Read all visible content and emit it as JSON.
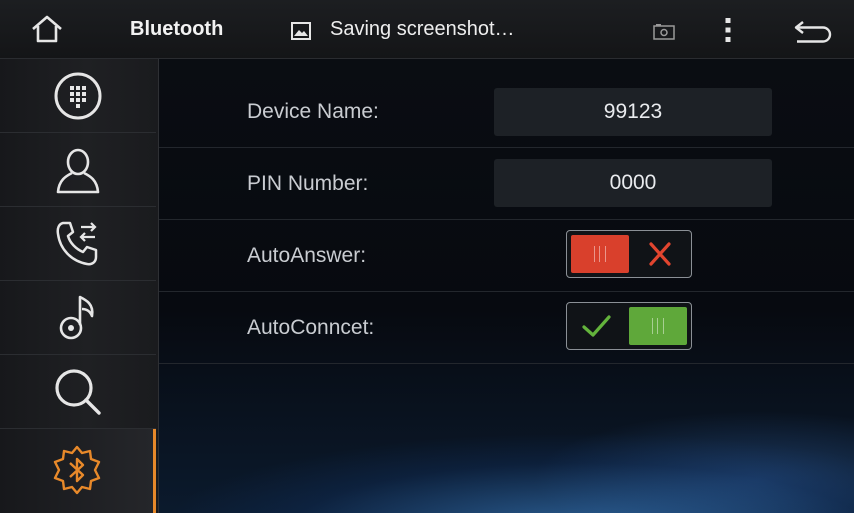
{
  "topbar": {
    "title": "Bluetooth",
    "notification": "Saving screenshot…",
    "icons": [
      "home-icon",
      "image-icon",
      "screenshot-icon",
      "overflow-menu-icon",
      "back-icon"
    ]
  },
  "sidebar": {
    "items": [
      {
        "name": "dialpad",
        "icon": "dialpad-icon"
      },
      {
        "name": "contacts",
        "icon": "person-icon"
      },
      {
        "name": "call-log",
        "icon": "phone-transfer-icon"
      },
      {
        "name": "music",
        "icon": "music-note-icon"
      },
      {
        "name": "search",
        "icon": "search-icon"
      },
      {
        "name": "bluetooth-settings",
        "icon": "bluetooth-gear-icon",
        "active": true
      }
    ],
    "active_color": "#e8892a"
  },
  "settings": {
    "device_name": {
      "label": "Device Name:",
      "value": "99123"
    },
    "pin_number": {
      "label": "PIN Number:",
      "value": "0000"
    },
    "auto_answer": {
      "label": "AutoAnswer:",
      "enabled": false,
      "off_color": "#d9402c"
    },
    "auto_connect": {
      "label": "AutoConncet:",
      "enabled": true,
      "on_color": "#5fa83a"
    }
  }
}
